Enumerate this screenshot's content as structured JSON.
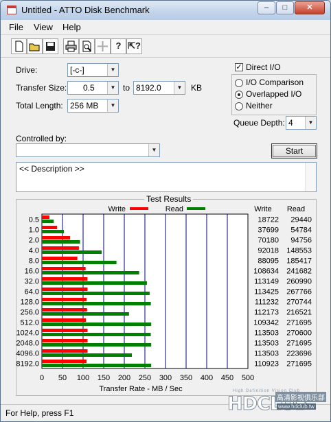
{
  "window": {
    "title": "Untitled - ATTO Disk Benchmark",
    "min_label": "0",
    "max_label": "1",
    "close_label": "r"
  },
  "menu": [
    "File",
    "View",
    "Help"
  ],
  "toolbar": [
    {
      "name": "new-icon",
      "glyph": "🗋"
    },
    {
      "name": "open-icon",
      "glyph": "📂"
    },
    {
      "name": "save-icon",
      "glyph": "💾"
    },
    {
      "name": "print-icon",
      "glyph": "🖶"
    },
    {
      "name": "print-preview-icon",
      "glyph": "🔍"
    },
    {
      "name": "move-icon",
      "glyph": "✥"
    },
    {
      "name": "help-icon",
      "glyph": "?"
    },
    {
      "name": "context-help-icon",
      "glyph": "?"
    }
  ],
  "form": {
    "drive_label": "Drive:",
    "drive_value": "[-c-]",
    "transfer_size_label": "Transfer Size:",
    "transfer_from": "0.5",
    "to_label": "to",
    "transfer_to": "8192.0",
    "kb_label": "KB",
    "total_length_label": "Total Length:",
    "total_length_value": "256 MB",
    "direct_io_label": "Direct I/O",
    "direct_io_checked": true,
    "io_comparison_label": "I/O Comparison",
    "overlapped_io_label": "Overlapped I/O",
    "neither_label": "Neither",
    "selected_mode": "Overlapped I/O",
    "queue_depth_label": "Queue Depth:",
    "queue_depth_value": "4",
    "controlled_by_label": "Controlled by:",
    "controlled_by_value": "",
    "start_label": "Start",
    "description": "<< Description >>"
  },
  "results": {
    "title": "Test Results",
    "write_legend": "Write",
    "read_legend": "Read",
    "write_header": "Write",
    "read_header": "Read"
  },
  "colors": {
    "write": "#ff0000",
    "read": "#008000",
    "grid": "#00007f"
  },
  "chart_data": {
    "type": "bar",
    "orientation": "horizontal",
    "categories": [
      "0.5",
      "1.0",
      "2.0",
      "4.0",
      "8.0",
      "16.0",
      "32.0",
      "64.0",
      "128.0",
      "256.0",
      "512.0",
      "1024.0",
      "2048.0",
      "4096.0",
      "8192.0"
    ],
    "series": [
      {
        "name": "Write",
        "values": [
          18722,
          37699,
          70180,
          92018,
          88095,
          108634,
          113149,
          113425,
          111232,
          112173,
          109342,
          113503,
          113503,
          113503,
          110923
        ]
      },
      {
        "name": "Read",
        "values": [
          29440,
          54784,
          94756,
          148553,
          185417,
          241682,
          260990,
          267766,
          270744,
          216521,
          271695,
          270600,
          271695,
          223696,
          271695
        ]
      }
    ],
    "xlabel": "Transfer Rate - MB / Sec",
    "xlim": [
      0,
      500
    ],
    "xticks": [
      "0",
      "50",
      "100",
      "150",
      "200",
      "250",
      "300",
      "350",
      "400",
      "450",
      "500"
    ],
    "value_units": "KB/sec",
    "grid": true,
    "legend": "top"
  },
  "statusbar": {
    "text": "For Help, press F1"
  },
  "watermark": {
    "small": "High Definition Vision Club",
    "big": "HDCLUB",
    "cn": "高清影视俱乐部",
    "url": "www.hdclub.tw"
  }
}
